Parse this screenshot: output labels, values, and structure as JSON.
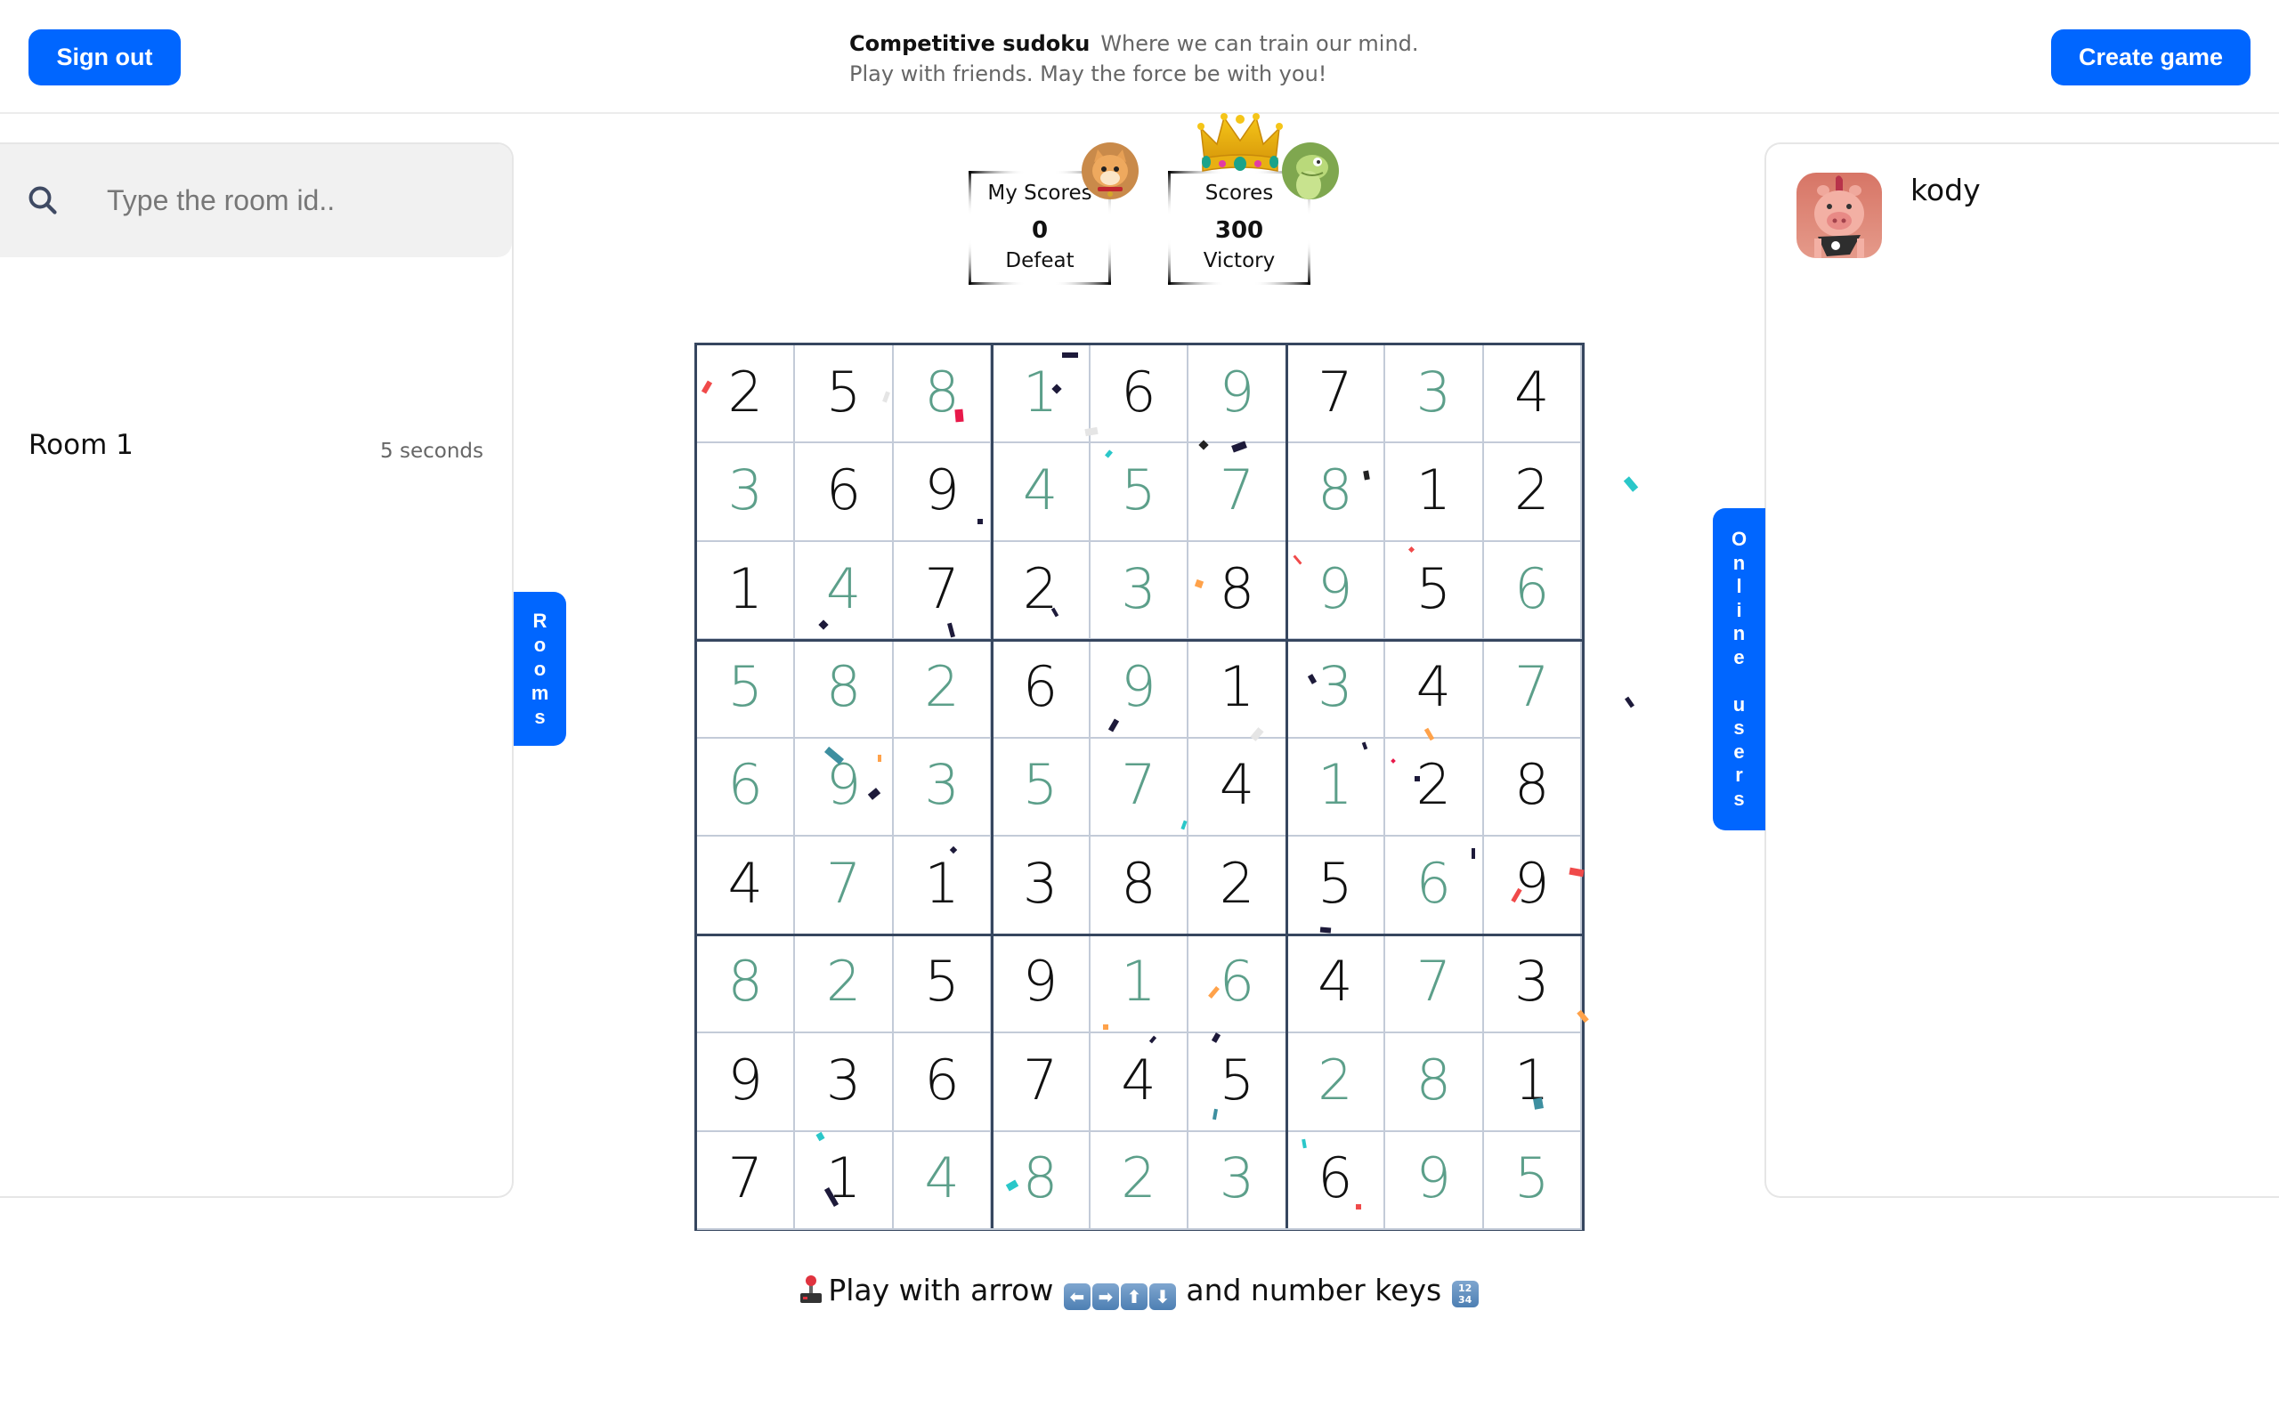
{
  "header": {
    "sign_out_label": "Sign out",
    "create_game_label": "Create game",
    "brand": "Competitive sudoku",
    "tagline_line1": "Where we can train our mind.",
    "tagline_line2": "Play with friends. May the force be with you!"
  },
  "left_panel": {
    "search_placeholder": "Type the room id..",
    "search_value": "",
    "rooms": [
      {
        "name": "Room 1",
        "time": "5 seconds"
      }
    ],
    "tab_label": "Rooms"
  },
  "right_panel": {
    "tab_label": "Online users",
    "users": [
      {
        "name": "kody",
        "avatar": "pig-avatar"
      }
    ]
  },
  "scores": {
    "mine": {
      "title": "My Scores",
      "value": "0",
      "result": "Defeat",
      "avatar": "cat-avatar"
    },
    "opponent": {
      "title": "Scores",
      "value": "300",
      "result": "Victory",
      "avatar": "dino-avatar",
      "winner": true
    }
  },
  "board": {
    "values": [
      [
        2,
        5,
        8,
        1,
        6,
        9,
        7,
        3,
        4
      ],
      [
        3,
        6,
        9,
        4,
        5,
        7,
        8,
        1,
        2
      ],
      [
        1,
        4,
        7,
        2,
        3,
        8,
        9,
        5,
        6
      ],
      [
        5,
        8,
        2,
        6,
        9,
        1,
        3,
        4,
        7
      ],
      [
        6,
        9,
        3,
        5,
        7,
        4,
        1,
        2,
        8
      ],
      [
        4,
        7,
        1,
        3,
        8,
        2,
        5,
        6,
        9
      ],
      [
        8,
        2,
        5,
        9,
        1,
        6,
        4,
        7,
        3
      ],
      [
        9,
        3,
        6,
        7,
        4,
        5,
        2,
        8,
        1
      ],
      [
        7,
        1,
        4,
        8,
        2,
        3,
        6,
        9,
        5
      ]
    ],
    "player_filled": [
      [
        0,
        0,
        1,
        1,
        0,
        1,
        0,
        1,
        0
      ],
      [
        1,
        0,
        0,
        1,
        1,
        1,
        1,
        0,
        0
      ],
      [
        0,
        1,
        0,
        0,
        1,
        0,
        1,
        0,
        1
      ],
      [
        1,
        1,
        1,
        0,
        1,
        0,
        1,
        0,
        1
      ],
      [
        1,
        1,
        1,
        1,
        1,
        0,
        1,
        0,
        0
      ],
      [
        0,
        1,
        0,
        0,
        0,
        0,
        0,
        1,
        0
      ],
      [
        1,
        1,
        0,
        0,
        1,
        1,
        0,
        1,
        0
      ],
      [
        0,
        0,
        0,
        0,
        0,
        0,
        1,
        1,
        0
      ],
      [
        0,
        0,
        1,
        1,
        1,
        1,
        0,
        1,
        1
      ]
    ],
    "filled_by_avatar": "dino-avatar",
    "colors": {
      "given": "#111111",
      "player": "#5c9f8a"
    }
  },
  "instruction": {
    "prefix": "Play with arrow",
    "keys": [
      "left-arrow",
      "right-arrow",
      "up-arrow",
      "down-arrow"
    ],
    "key_glyphs": [
      "⬅",
      "➡",
      "⬆",
      "⬇"
    ],
    "middle": "and number keys",
    "numbers_glyph": "12 34"
  },
  "colors": {
    "accent": "#0066ff",
    "grid_border": "#36465f",
    "grid_inner": "#c3cbd8"
  }
}
